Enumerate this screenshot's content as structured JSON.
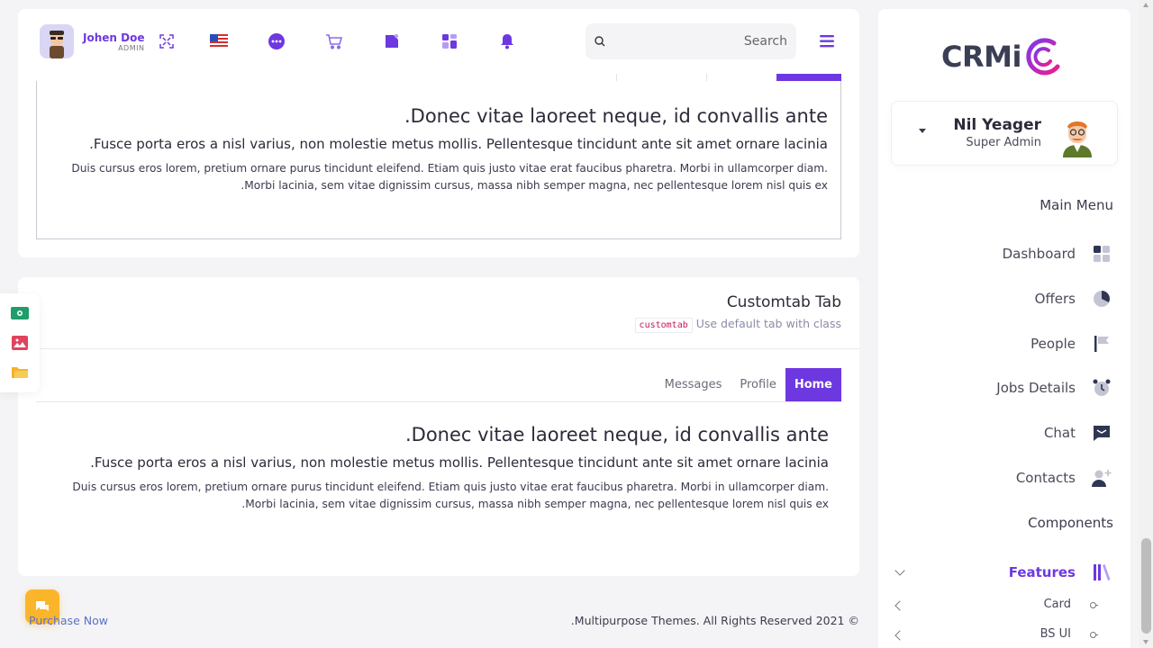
{
  "header": {
    "user_name": "Johen Doe",
    "user_role": "ADMIN",
    "icons": [
      "fullscreen-icon",
      "us-flag-icon",
      "chat-bubble-icon",
      "cart-icon",
      "document-icon",
      "dashboard-widget-icon",
      "bell-icon"
    ],
    "search_placeholder": "Search",
    "menu_icon": "hamburger-icon"
  },
  "card1": {
    "title": "Donec vitae laoreet neque, id convallis ante.",
    "lead": "Fusce porta eros a nisl varius, non molestie metus mollis. Pellentesque tincidunt ante sit amet ornare lacinia.",
    "body": "Duis cursus eros lorem, pretium ornare purus tincidunt eleifend. Etiam quis justo vitae erat faucibus pharetra. Morbi in ullamcorper diam. Morbi lacinia, sem vitae dignissim cursus, massa nibh semper magna, nec pellentesque lorem nisl quis ex."
  },
  "card2": {
    "title": "Customtab Tab",
    "subtitle": "Use default tab with class",
    "subtitle_code": "customtab",
    "tabs": [
      "Messages",
      "Profile",
      "Home"
    ],
    "active_tab": "Home",
    "pane_title": "Donec vitae laoreet neque, id convallis ante.",
    "pane_lead": "Fusce porta eros a nisl varius, non molestie metus mollis. Pellentesque tincidunt ante sit amet ornare lacinia.",
    "pane_body": "Duis cursus eros lorem, pretium ornare purus tincidunt eleifend. Etiam quis justo vitae erat faucibus pharetra. Morbi in ullamcorper diam. Morbi lacinia, sem vitae dignissim cursus, massa nibh semper magna, nec pellentesque lorem nisl quis ex."
  },
  "float_widgets": [
    "money-icon",
    "image-icon",
    "folder-icon"
  ],
  "footer": {
    "purchase": "Purchase Now",
    "copyright": "© 2021 Multipurpose Themes. All Rights Reserved."
  },
  "sidebar": {
    "logo": "CRMi",
    "profile_name": "Nil Yeager",
    "profile_role": "Super Admin",
    "main_menu": "Main Menu",
    "items": [
      {
        "label": "Dashboard",
        "icon": "dashboard-icon"
      },
      {
        "label": "Offers",
        "icon": "pie-chart-icon"
      },
      {
        "label": "People",
        "icon": "flag-icon"
      },
      {
        "label": "Jobs Details",
        "icon": "alarm-clock-icon"
      },
      {
        "label": "Chat",
        "icon": "chat-icon"
      },
      {
        "label": "Contacts",
        "icon": "add-user-icon"
      }
    ],
    "components": "Components",
    "features": "Features",
    "sub_items": [
      "Card",
      "BS UI"
    ]
  },
  "colors": {
    "accent": "#6d38e0",
    "fab": "#fbb52a",
    "background": "#f4f4f6"
  }
}
